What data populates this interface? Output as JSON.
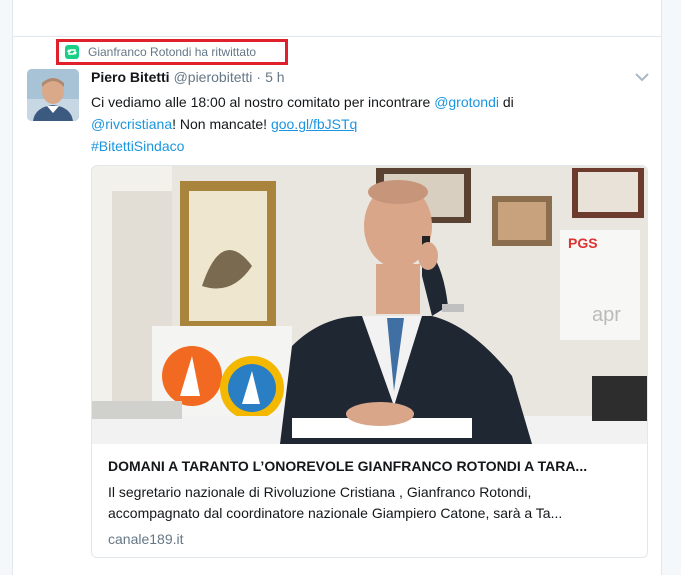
{
  "retweet_context": {
    "text": "Gianfranco Rotondi ha ritwittato",
    "icon": "retweet-icon",
    "icon_color": "#19cf86",
    "highlight_color": "#e0202a"
  },
  "tweet": {
    "fullname": "Piero Bitetti",
    "screenname": "@pierobitetti",
    "separator": "·",
    "time": "5 h",
    "menu_icon": "chevron-down-icon",
    "text": {
      "part1": "Ci vediamo alle 18:00 al nostro comitato per incontrare ",
      "mention1": "@grotondi",
      "part2": " di",
      "mention2": "@rivcristiana",
      "part3": "! Non mancate! ",
      "link": "goo.gl/fbJSTq",
      "hashtag": "#BitettiSindaco"
    }
  },
  "card": {
    "title": "DOMANI A TARANTO L’ONOREVOLE GIANFRANCO ROTONDI A TARA...",
    "description_line1": "Il segretario nazionale di Rivoluzione Cristiana , Gianfranco Rotondi,",
    "description_line2": "accompagnato dal coordinatore nazionale Giampiero Catone, sarà a Ta...",
    "domain": "canale189.it"
  },
  "colors": {
    "link": "#1b95e0",
    "text_primary": "#14171a",
    "text_secondary": "#657786"
  }
}
